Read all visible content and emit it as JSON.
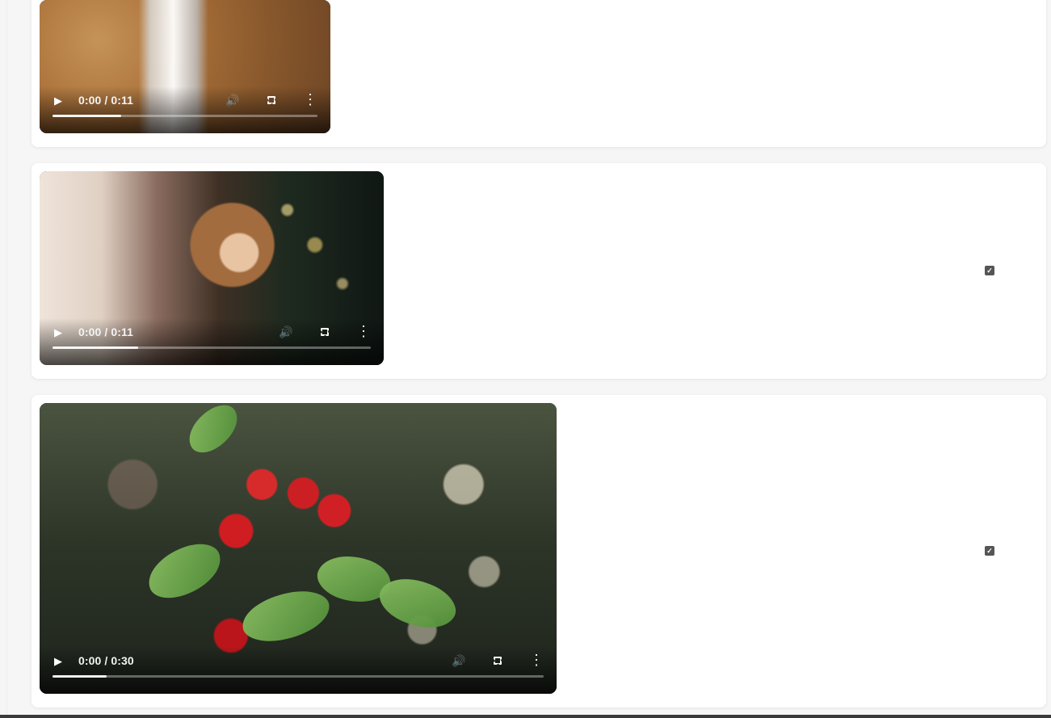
{
  "videos": [
    {
      "name": "desert-video",
      "time": "0:00 / 0:11",
      "progress": 0.26,
      "play_icon": "play-icon",
      "volume_icon": "volume-icon",
      "fullscreen_icon": "fullscreen-icon",
      "more_icon": "more-vert-icon"
    },
    {
      "name": "party-video",
      "time": "0:00 / 0:11",
      "progress": 0.27,
      "play_icon": "play-icon",
      "volume_icon": "volume-icon",
      "fullscreen_icon": "fullscreen-icon",
      "more_icon": "more-vert-icon",
      "checkbox_checked": true
    },
    {
      "name": "cherry-video",
      "time": "0:00 / 0:30",
      "progress": 0.11,
      "play_icon": "play-icon",
      "volume_icon": "volume-icon",
      "fullscreen_icon": "fullscreen-icon",
      "more_icon": "more-vert-icon",
      "checkbox_checked": true
    }
  ],
  "colors": {
    "page_background": "#f5f5f5",
    "card_background": "#ffffff",
    "checkbox": "#555555",
    "bottom_bar": "#3a3a3a"
  }
}
